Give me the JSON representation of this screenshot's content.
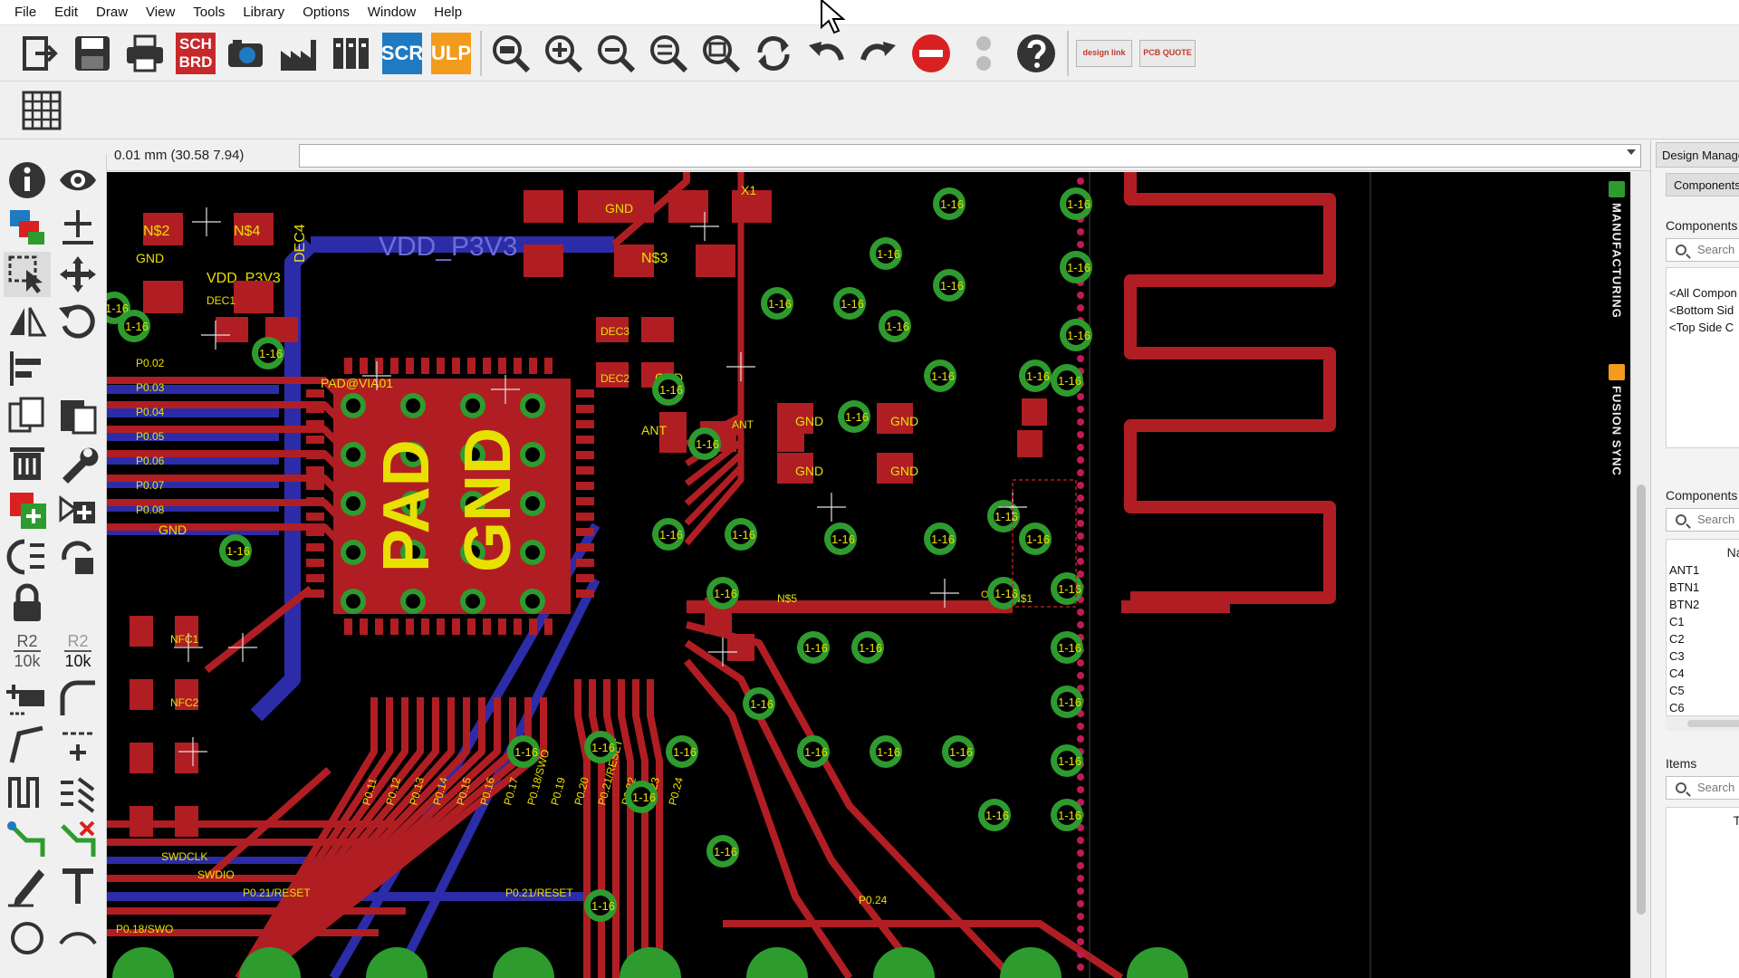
{
  "menu": [
    "File",
    "Edit",
    "Draw",
    "View",
    "Tools",
    "Library",
    "Options",
    "Window",
    "Help"
  ],
  "toolbar": {
    "sch_brd_top": "SCH",
    "sch_brd_bottom": "BRD",
    "scr": "SCR",
    "ulp": "ULP",
    "design_link_label": "design link",
    "pcb_quote_label": "PCB QUOTE"
  },
  "command": {
    "coordinates": "0.01 mm (30.58 7.94)",
    "value": ""
  },
  "palette": {
    "name_label": "R2",
    "value_label_1": "10k",
    "value_label_2": "10k"
  },
  "side_tabs": {
    "manufacturing": "MANUFACTURING",
    "fusion_sync": "FUSION SYNC"
  },
  "panel": {
    "title": "Design Manager",
    "tab": "Components",
    "section1_label": "Components",
    "search_placeholder": "Search",
    "filters": [
      "<All Compon",
      "<Bottom Sid",
      "<Top Side C"
    ],
    "section2_label": "Components",
    "name_column": "Name",
    "components": [
      "ANT1",
      "BTN1",
      "BTN2",
      "C1",
      "C2",
      "C3",
      "C4",
      "C5",
      "C6"
    ],
    "items_label": "Items",
    "type_column": "Type"
  },
  "board": {
    "net_label": "VDD_P3V3",
    "via_label": "1-16",
    "pad_text": "PAD",
    "gnd_text": "GND",
    "signals_left": [
      "P0.02",
      "P0.03",
      "P0.04",
      "P0.05",
      "P0.06",
      "P0.07",
      "P0.08"
    ],
    "signals_bottom": [
      "P0.11",
      "P0.12",
      "P0.13",
      "P0.14",
      "P0.15",
      "P0.16",
      "P0.17",
      "P0.18/SWO",
      "P0.19",
      "P0.20",
      "P0.21/RESET",
      "P0.22",
      "P0.23",
      "P0.24"
    ],
    "labels": {
      "dec1": "DEC1",
      "dec2": "DEC2",
      "dec3": "DEC3",
      "dec4": "DEC4",
      "x1": "X1",
      "ant": "ANT",
      "nfc1": "NFC1",
      "nfc2": "NFC2",
      "ns2": "N$2",
      "ns3": "N$3",
      "ns4": "N$4",
      "ns5": "N$5",
      "ns1": "N$1",
      "out": "OUT",
      "swdclk": "SWDCLK",
      "swdio": "SWDIO",
      "reset_net": "P0.21/RESET",
      "swo_net": "P0.18/SWO",
      "pad_via": "PAD@VIA01",
      "p0_24": "P0.24"
    }
  },
  "colors": {
    "copper_top": "#b01e23",
    "copper_bottom": "#2c2ca8",
    "via_ring": "#2e9b2e",
    "silk": "#e8e000",
    "canvas": "#000000"
  }
}
